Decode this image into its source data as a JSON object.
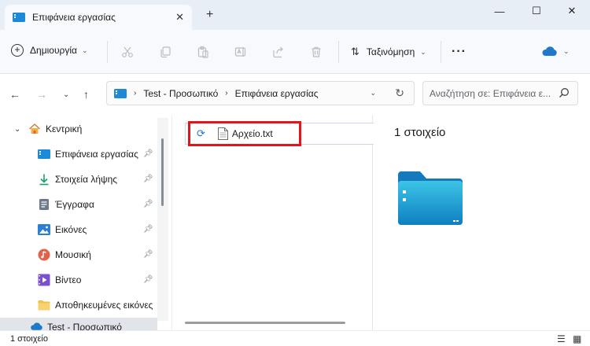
{
  "window": {
    "tab_title": "Επιφάνεια εργασίας",
    "tab_close": "✕",
    "new_tab": "+",
    "minimize": "—",
    "maximize": "☐",
    "close": "✕"
  },
  "toolbar": {
    "new_label": "Δημιουργία",
    "sort_label": "Ταξινόμηση",
    "more_label": "···",
    "icons": [
      "cut-icon",
      "copy-icon",
      "paste-icon",
      "rename-icon",
      "share-icon",
      "delete-icon"
    ],
    "cloud_color": "#1f79c8"
  },
  "address": {
    "crumbs": [
      "Test - Προσωπικό",
      "Επιφάνεια εργασίας"
    ],
    "search_placeholder": "Αναζήτηση σε: Επιφάνεια ε..."
  },
  "sidebar": {
    "home_label": "Κεντρική",
    "items": [
      {
        "label": "Επιφάνεια εργασίας",
        "icon": "desktop-icon",
        "pinned": true
      },
      {
        "label": "Στοιχεία λήψης",
        "icon": "download-icon",
        "pinned": true
      },
      {
        "label": "Έγγραφα",
        "icon": "documents-icon",
        "pinned": true
      },
      {
        "label": "Εικόνες",
        "icon": "pictures-icon",
        "pinned": true
      },
      {
        "label": "Μουσική",
        "icon": "music-icon",
        "pinned": true
      },
      {
        "label": "Βίντεο",
        "icon": "videos-icon",
        "pinned": true
      },
      {
        "label": "Αποθηκευμένες εικόνες",
        "icon": "folder-icon",
        "pinned": false
      }
    ],
    "partial_label": "Test - Προσωπικό"
  },
  "files": [
    {
      "name": "Αρχείο.txt",
      "status": "sync-pending"
    }
  ],
  "details": {
    "count_label": "1 στοιχείο"
  },
  "status": {
    "count_label": "1 στοιχείο"
  },
  "colors": {
    "highlight": "#e3151a",
    "accent": "#1f79c8"
  }
}
